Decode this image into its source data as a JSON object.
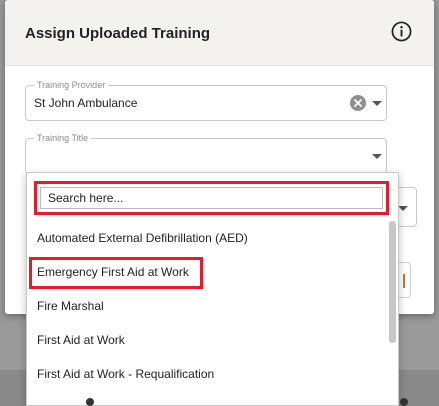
{
  "modal": {
    "title": "Assign Uploaded Training",
    "info_icon": "info-circle-icon"
  },
  "fields": {
    "provider": {
      "label": "Training Provider",
      "value": "St John Ambulance"
    },
    "title": {
      "label": "Training Title",
      "value": ""
    }
  },
  "dropdown": {
    "search_placeholder": "Search here...",
    "options": [
      "Automated External Defibrillation (AED)",
      "Emergency First Aid at Work",
      "Fire Marshal",
      "First Aid at Work",
      "First Aid at Work - Requalification"
    ],
    "highlighted_option": "Emergency First Aid at Work"
  },
  "colors": {
    "highlight": "#e21c2a",
    "header_bg": "#f3f2ef"
  }
}
